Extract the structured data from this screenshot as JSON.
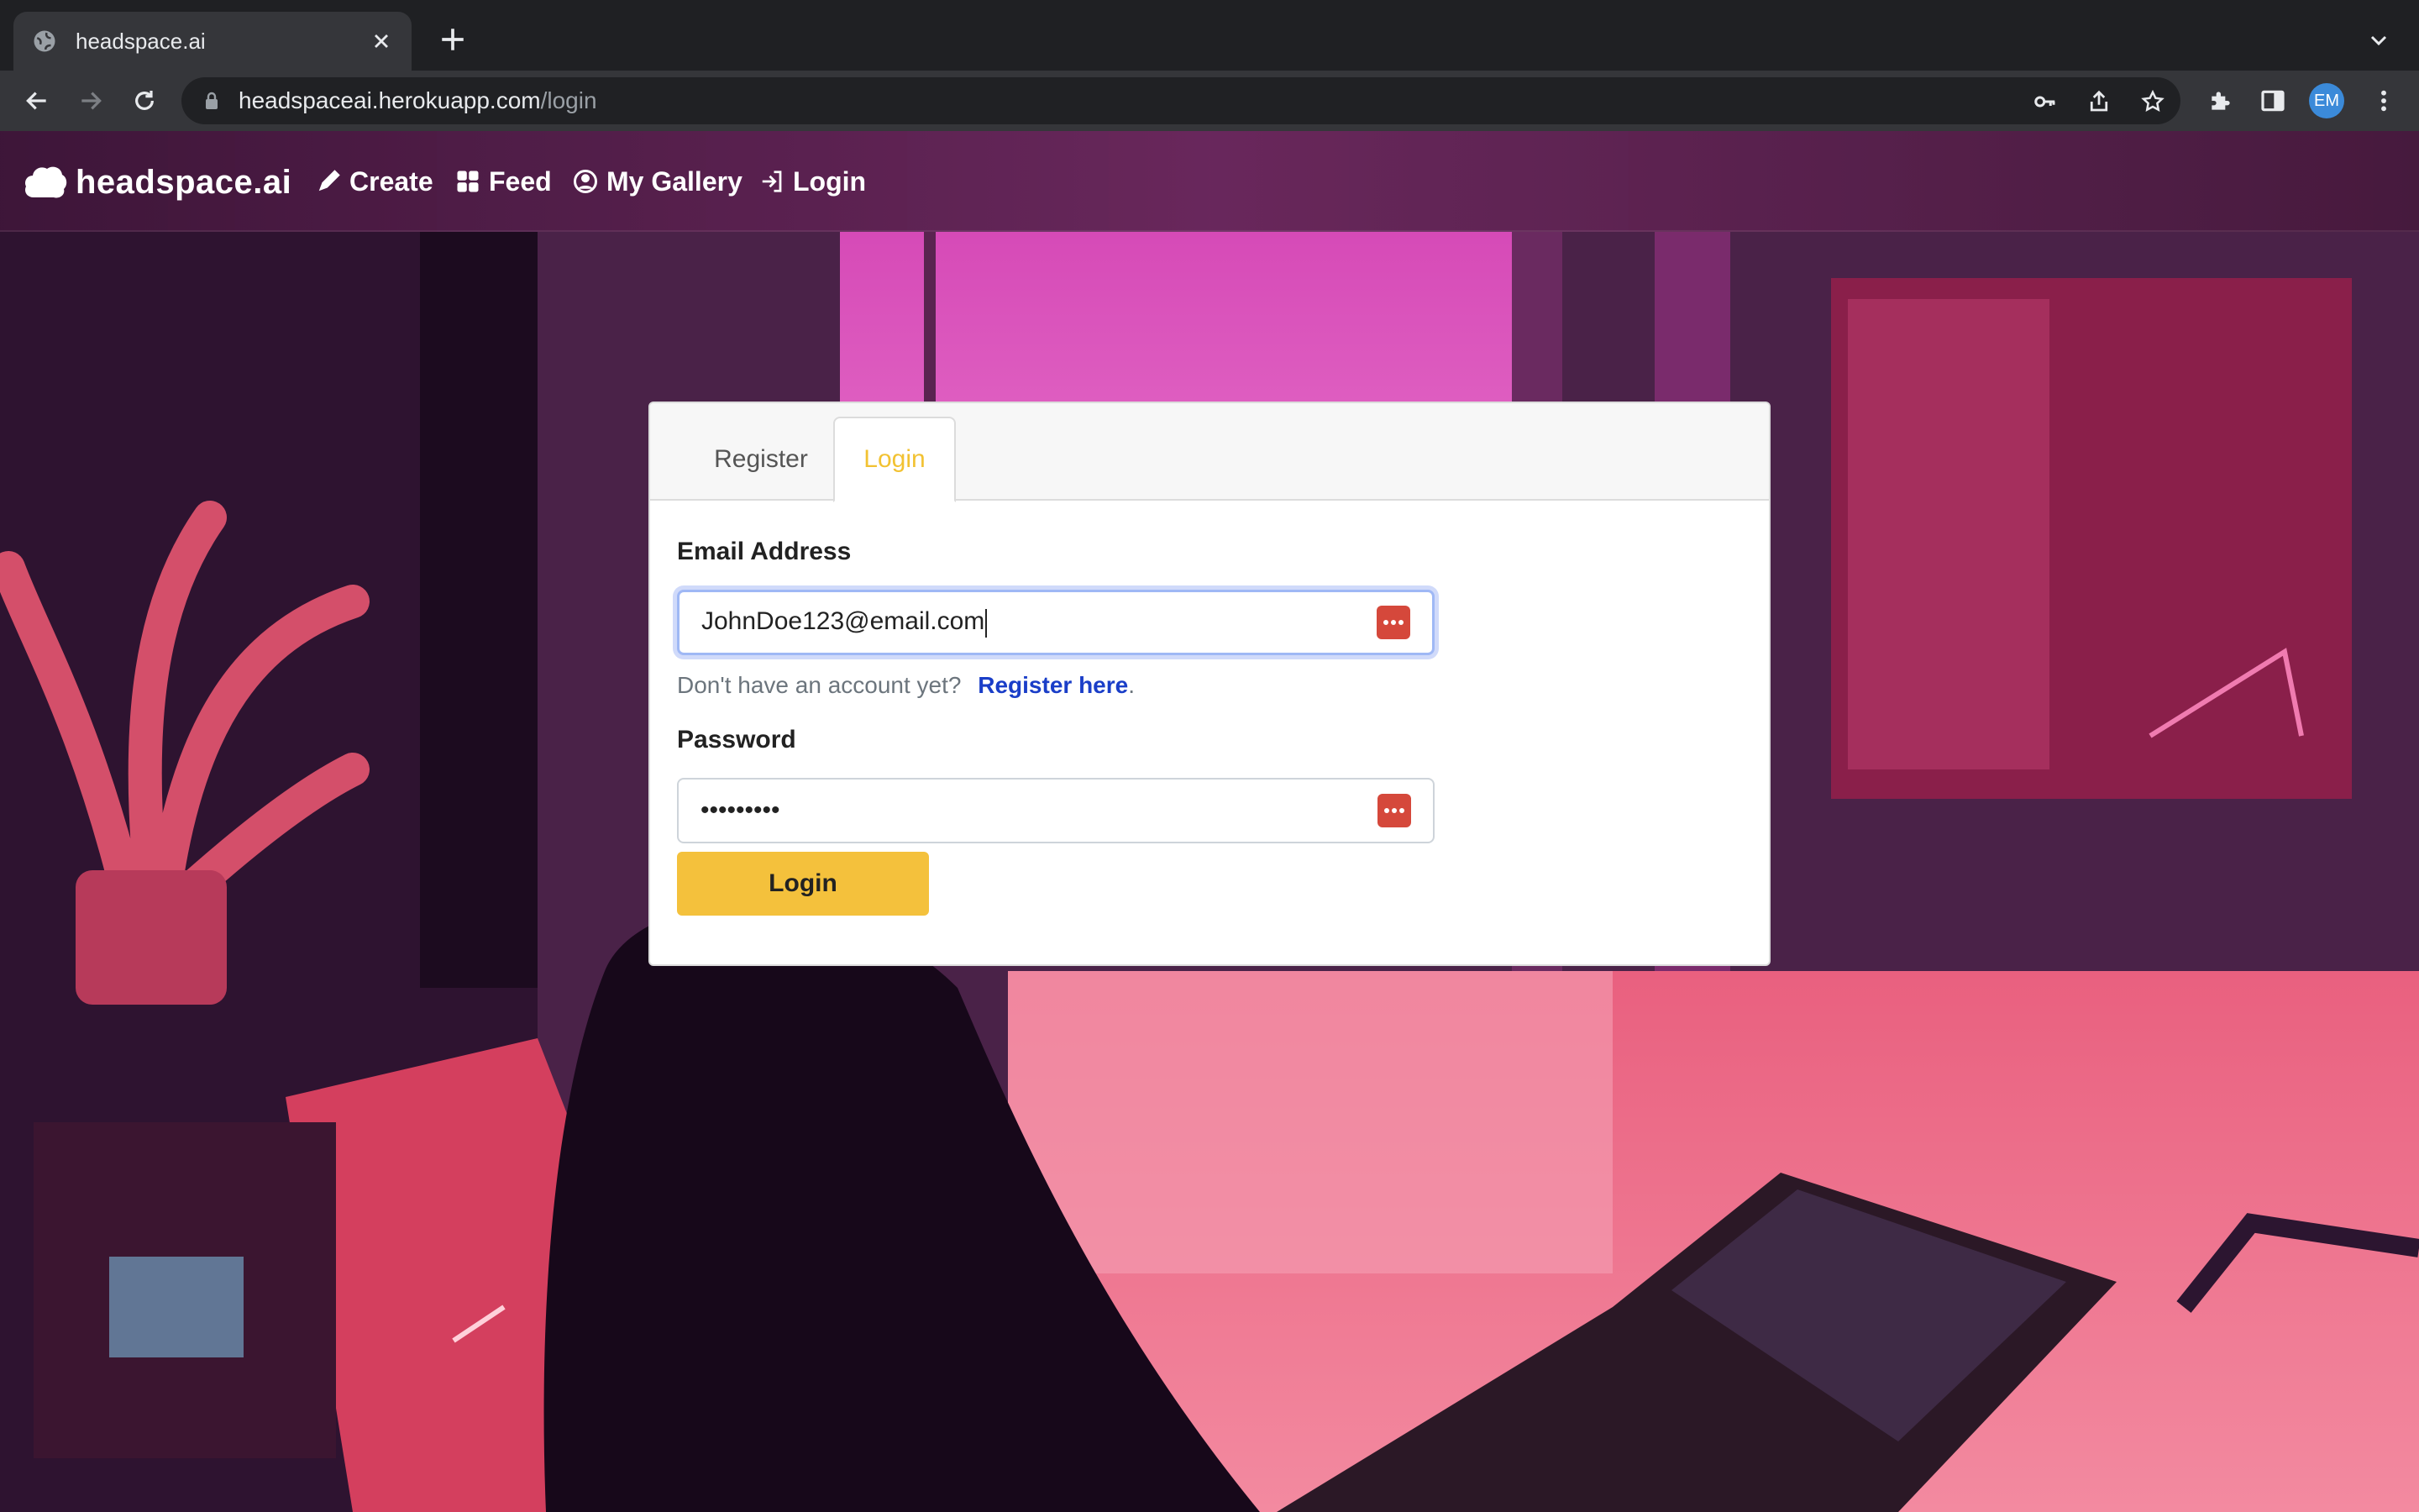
{
  "browser": {
    "tab_title": "headspace.ai",
    "url_host": "headspaceai.herokuapp.com",
    "url_path": "/login",
    "profile_initials": "EM"
  },
  "navbar": {
    "brand": "headspace.ai",
    "links": [
      "Create",
      "Feed",
      "My Gallery",
      "Login"
    ]
  },
  "card": {
    "tabs": [
      "Register",
      "Login"
    ],
    "active_tab": "Login",
    "email_label": "Email Address",
    "email_value": "JohnDoe123@email.com",
    "helper_text": "Don't have an account yet?",
    "helper_link": "Register here",
    "helper_suffix": ".",
    "password_label": "Password",
    "password_value": "•••••••••",
    "submit_label": "Login"
  },
  "colors": {
    "accent": "#f4c13c",
    "link": "#1a3ec8",
    "password_manager_icon": "#d5483b"
  }
}
